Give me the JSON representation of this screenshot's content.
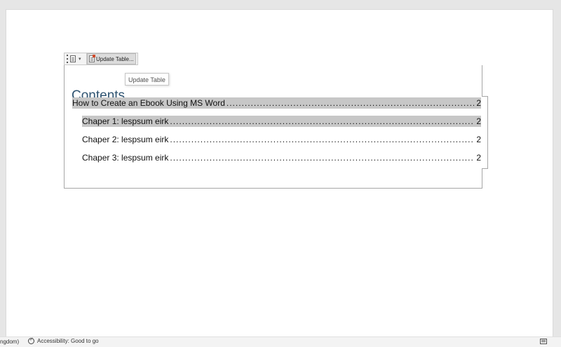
{
  "toc_toolbar": {
    "update_label": "Update Table...",
    "tooltip": "Update Table"
  },
  "toc": {
    "title": "Contents",
    "dots": "................................................................................................................................................................................................",
    "entries": [
      {
        "label": "How to Create an Ebook Using MS Word",
        "page": "2"
      },
      {
        "label": "Chaper 1: lespsum eirk",
        "page": "2"
      },
      {
        "label": "Chaper 2: lespsum eirk",
        "page": "2"
      },
      {
        "label": "Chaper 3: lespsum eirk",
        "page": "2"
      }
    ]
  },
  "statusbar": {
    "language": "ngdom)",
    "accessibility": "Accessibility: Good to go"
  }
}
